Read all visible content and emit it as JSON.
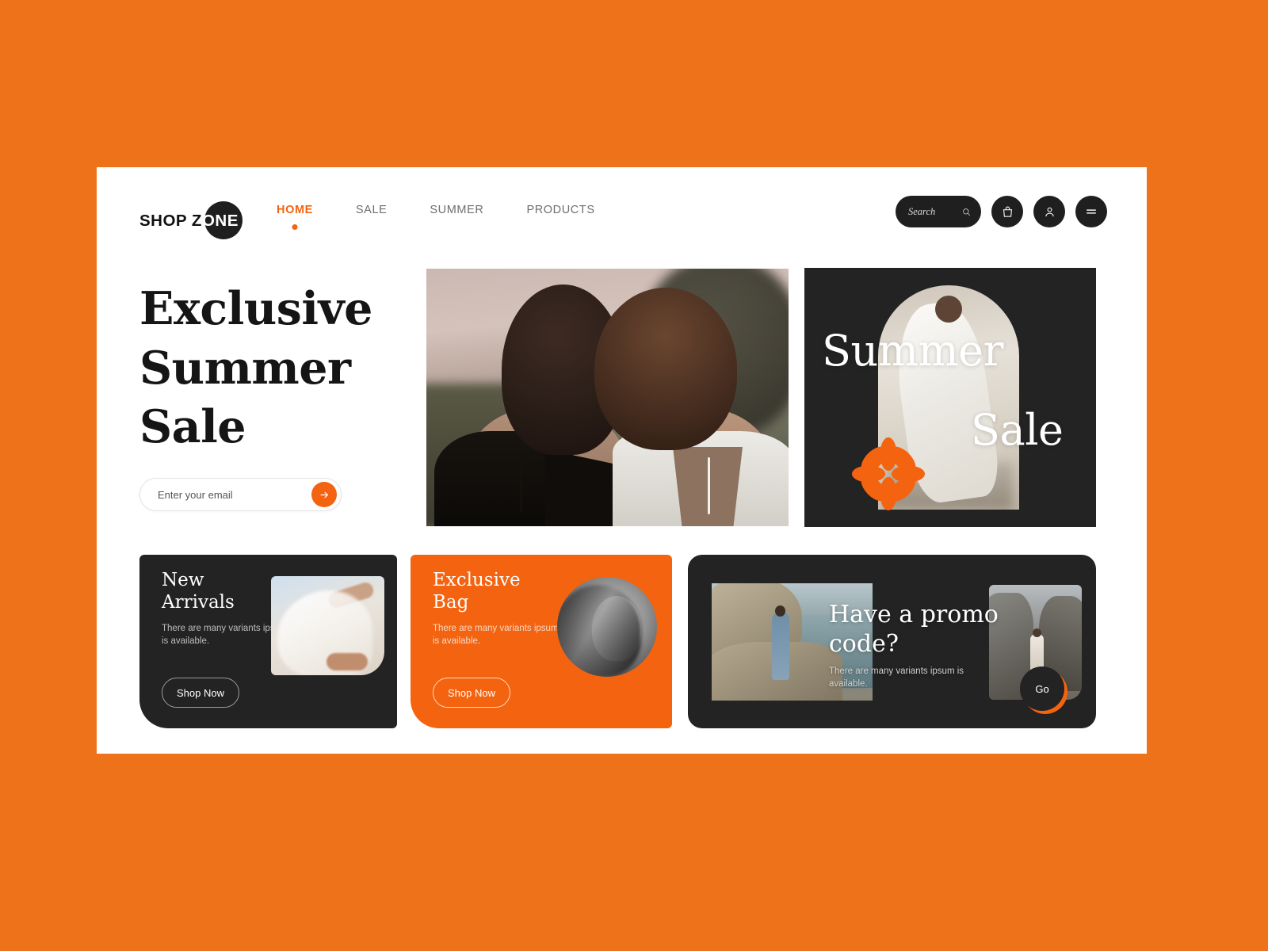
{
  "theme": {
    "background_orange": "#ee7219",
    "accent_orange": "#f4630f",
    "dark": "#232323",
    "page_white": "#ffffff"
  },
  "header": {
    "logo": {
      "word1": "SHOP Z",
      "word2": "ONE",
      "icon": "logo-circle"
    },
    "nav": [
      {
        "label": "HOME",
        "active": true
      },
      {
        "label": "SALE",
        "active": false
      },
      {
        "label": "SUMMER",
        "active": false
      },
      {
        "label": "PRODUCTS",
        "active": false
      }
    ],
    "search": {
      "placeholder": "Search",
      "value": "",
      "icon": "search-icon"
    },
    "actions": [
      {
        "name": "bag-icon"
      },
      {
        "name": "user-icon"
      },
      {
        "name": "hamburger-icon"
      }
    ]
  },
  "hero": {
    "title_line1": "Exclusive",
    "title_line2": "Summer",
    "title_line3": "Sale",
    "email": {
      "placeholder": "Enter your email",
      "value": "",
      "submit_icon": "arrow-right-icon"
    },
    "photo_alt": "two-women-backs-dusk"
  },
  "summer_card": {
    "title_line1": "Summer",
    "title_line2": "Sale",
    "decor_icon": "flower-icon",
    "photo_alt": "woman-white-dress-arch"
  },
  "cards": {
    "new_arrivals": {
      "heading_line1": "New",
      "heading_line2": "Arrivals",
      "body_line1": "There are many variants",
      "body_line2": "ipsum is available.",
      "cta": "Shop Now",
      "photo_alt": "woman-with-sheer-veil"
    },
    "exclusive_bag": {
      "heading_line1": "Exclusive",
      "heading_line2": "Bag",
      "body_line1": "There are many variants",
      "body_line2": "ipsum is available.",
      "cta": "Shop Now",
      "photo_alt": "bw-portrait-circle"
    },
    "promo": {
      "heading_line1": "Have a promo",
      "heading_line2": "code?",
      "body_line1": "There are many variants",
      "body_line2": "ipsum is available.",
      "cta": "Go",
      "photo_a_alt": "woman-blue-dress-rocky-coast",
      "photo_b_alt": "woman-white-dress-rocks"
    }
  }
}
